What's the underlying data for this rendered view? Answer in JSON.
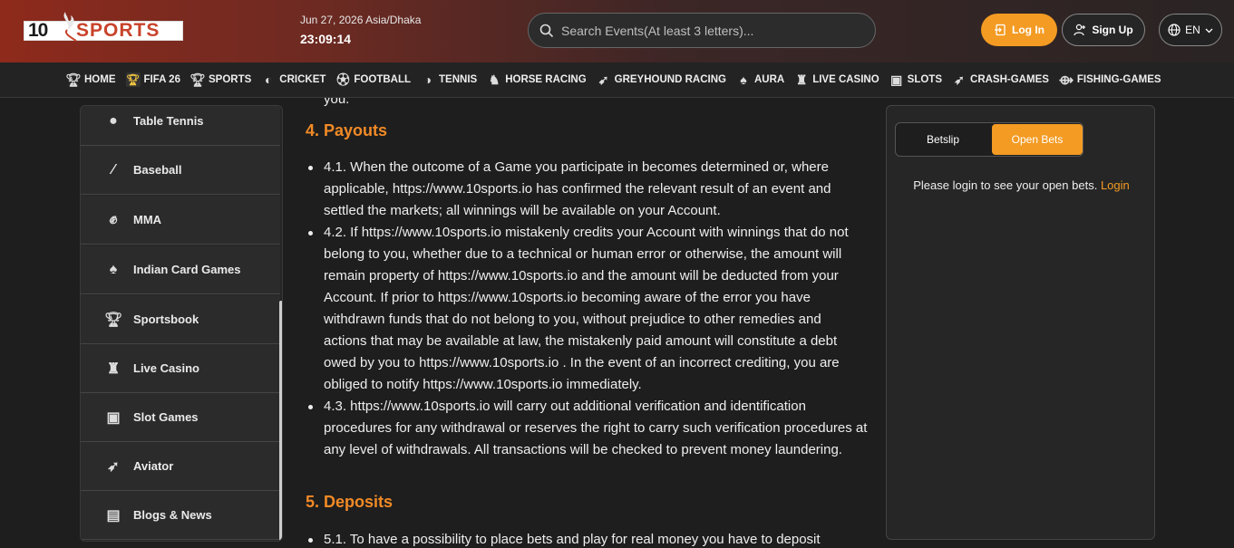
{
  "brand": {
    "num": "10",
    "word": "SPORTS"
  },
  "header": {
    "date": "Jun 27, 2026 Asia/Dhaka",
    "time": "23:09:14",
    "search_placeholder": "Search Events(At least 3 letters)...",
    "login_label": "Log In",
    "signup_label": "Sign Up",
    "lang_label": "EN"
  },
  "nav": [
    {
      "label": "HOME",
      "icon": "trophy-icon"
    },
    {
      "label": "FIFA 26",
      "icon": "fifa-icon"
    },
    {
      "label": "SPORTS",
      "icon": "trophy-icon"
    },
    {
      "label": "CRICKET",
      "icon": "cricket-icon"
    },
    {
      "label": "FOOTBALL",
      "icon": "football-icon"
    },
    {
      "label": "TENNIS",
      "icon": "tennis-icon"
    },
    {
      "label": "HORSE RACING",
      "icon": "horse-icon"
    },
    {
      "label": "GREYHOUND RACING",
      "icon": "greyhound-icon"
    },
    {
      "label": "AURA",
      "icon": "spade-icon"
    },
    {
      "label": "LIVE CASINO",
      "icon": "dealer-icon"
    },
    {
      "label": "SLOTS",
      "icon": "slots-icon"
    },
    {
      "label": "CRASH-GAMES",
      "icon": "rocket-icon"
    },
    {
      "label": "FISHING-GAMES",
      "icon": "fish-icon"
    }
  ],
  "sidebar": [
    {
      "label": "Table Tennis",
      "icon": "table-tennis-icon"
    },
    {
      "label": "Baseball",
      "icon": "baseball-bat-icon"
    },
    {
      "label": "MMA",
      "icon": "glove-icon"
    },
    {
      "label": "Indian Card Games",
      "icon": "spade-icon"
    },
    {
      "label": "Sportsbook",
      "icon": "trophy-icon"
    },
    {
      "label": "Live Casino",
      "icon": "dealer-icon"
    },
    {
      "label": "Slot Games",
      "icon": "slots-icon"
    },
    {
      "label": "Aviator",
      "icon": "rocket-icon"
    },
    {
      "label": "Blogs & News",
      "icon": "document-icon"
    }
  ],
  "content": {
    "fragment": "you.",
    "section4_title": "4. Payouts",
    "section4_items": [
      "4.1. When the outcome of a Game you participate in becomes determined or, where applicable, https://www.10sports.io has confirmed the relevant result of an event and settled the markets; all winnings will be available on your Account.",
      "4.2. If https://www.10sports.io mistakenly credits your Account with winnings that do not belong to you, whether due to a technical or human error or otherwise, the amount will remain property of https://www.10sports.io and the amount will be deducted from your Account. If prior to https://www.10sports.io becoming aware of the error you have withdrawn funds that do not belong to you, without prejudice to other remedies and actions that may be available at law, the mistakenly paid amount will constitute a debt owed by you to https://www.10sports.io . In the event of an incorrect crediting, you are obliged to notify https://www.10sports.io immediately.",
      "4.3. https://www.10sports.io will carry out additional verification and identification procedures for any withdrawal or reserves the right to carry such verification procedures at any level of withdrawals. All transactions will be checked to prevent money laundering."
    ],
    "section5_title": "5. Deposits",
    "section5_items": [
      "5.1. To have a possibility to place bets and play for real money you have to deposit"
    ]
  },
  "betpanel": {
    "tab_betslip": "Betslip",
    "tab_openbets": "Open Bets",
    "message": "Please login to see your open bets.",
    "login_link": "Login"
  }
}
